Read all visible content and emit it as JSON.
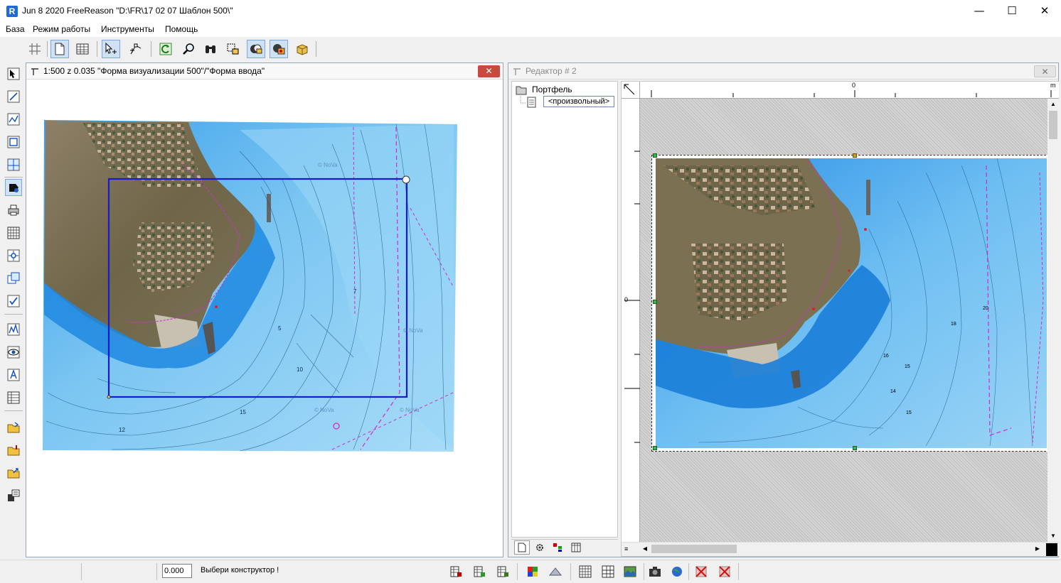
{
  "app": {
    "title": "Jun  8 2020 FreeReason \"D:\\FR\\17 02 07 Шаблон 500\\\"",
    "icon_letter": "R",
    "minimize_glyph": "—",
    "maximize_glyph": "☐",
    "close_glyph": "✕"
  },
  "menu": [
    {
      "label": "База"
    },
    {
      "label": "Режим работы"
    },
    {
      "label": "Инструменты"
    },
    {
      "label": "Помощь"
    }
  ],
  "toolbar": {
    "icons": [
      "grid-icon",
      "new-document-icon",
      "table-icon",
      "select-pointer-icon",
      "node-edit-icon",
      "refresh-icon",
      "zoom-icon",
      "binoculars-icon",
      "select-objects-icon",
      "layers-icon",
      "layer-settings-icon",
      "package-icon"
    ]
  },
  "left_toolbar": {
    "icons": [
      "select-icon",
      "line-icon",
      "polyline-icon",
      "rectangle-icon",
      "area-icon",
      "fill-icon",
      "print-icon",
      "grid-table-icon",
      "point-icon",
      "overlap-icon",
      "edit-check-icon",
      "chart-icon",
      "eye-icon",
      "text-icon",
      "table-list-icon",
      "open-folder-icon",
      "open-folder-red-icon",
      "folder-export-icon",
      "save-stack-icon"
    ]
  },
  "map_window": {
    "title": "1:500 z 0.035 \"Форма визуализации 500\"/\"Форма ввода\"",
    "close_glyph": "✕",
    "depth_labels": [
      "5",
      "7",
      "10",
      "12",
      "15"
    ],
    "watermark": "© NoVa"
  },
  "editor_window": {
    "title": "Редактор # 2",
    "close_glyph": "✕",
    "tree": {
      "root_label": "Портфель",
      "child_label": "<произвольный>"
    },
    "ruler": {
      "zero_label": "0",
      "unit_label": "m",
      "vertical_zero_label": "0"
    },
    "map_labels": [
      "15",
      "14",
      "16",
      "20",
      "18",
      "15"
    ],
    "bottom_tabs": [
      "page-tab-icon",
      "gear-tab-icon",
      "tree-tab-icon",
      "table-tab-icon"
    ]
  },
  "statusbar": {
    "value": "0.000",
    "message": "Выбери конструктор !",
    "icons": [
      "db-table-icon",
      "db-add-icon",
      "db-edit-icon",
      "color-palette-icon",
      "shape-icon",
      "grid-small-icon",
      "grid-large-icon",
      "photo-icon",
      "camera-icon",
      "globe-icon",
      "no-layer-icon",
      "no-draw-icon"
    ]
  },
  "colors": {
    "selection_frame": "#1a1acc",
    "water_light": "#8fd0f4",
    "water_deep": "#2a8fe0",
    "close_red": "#c84a3e",
    "boundary_magenta": "#d02ad0"
  }
}
